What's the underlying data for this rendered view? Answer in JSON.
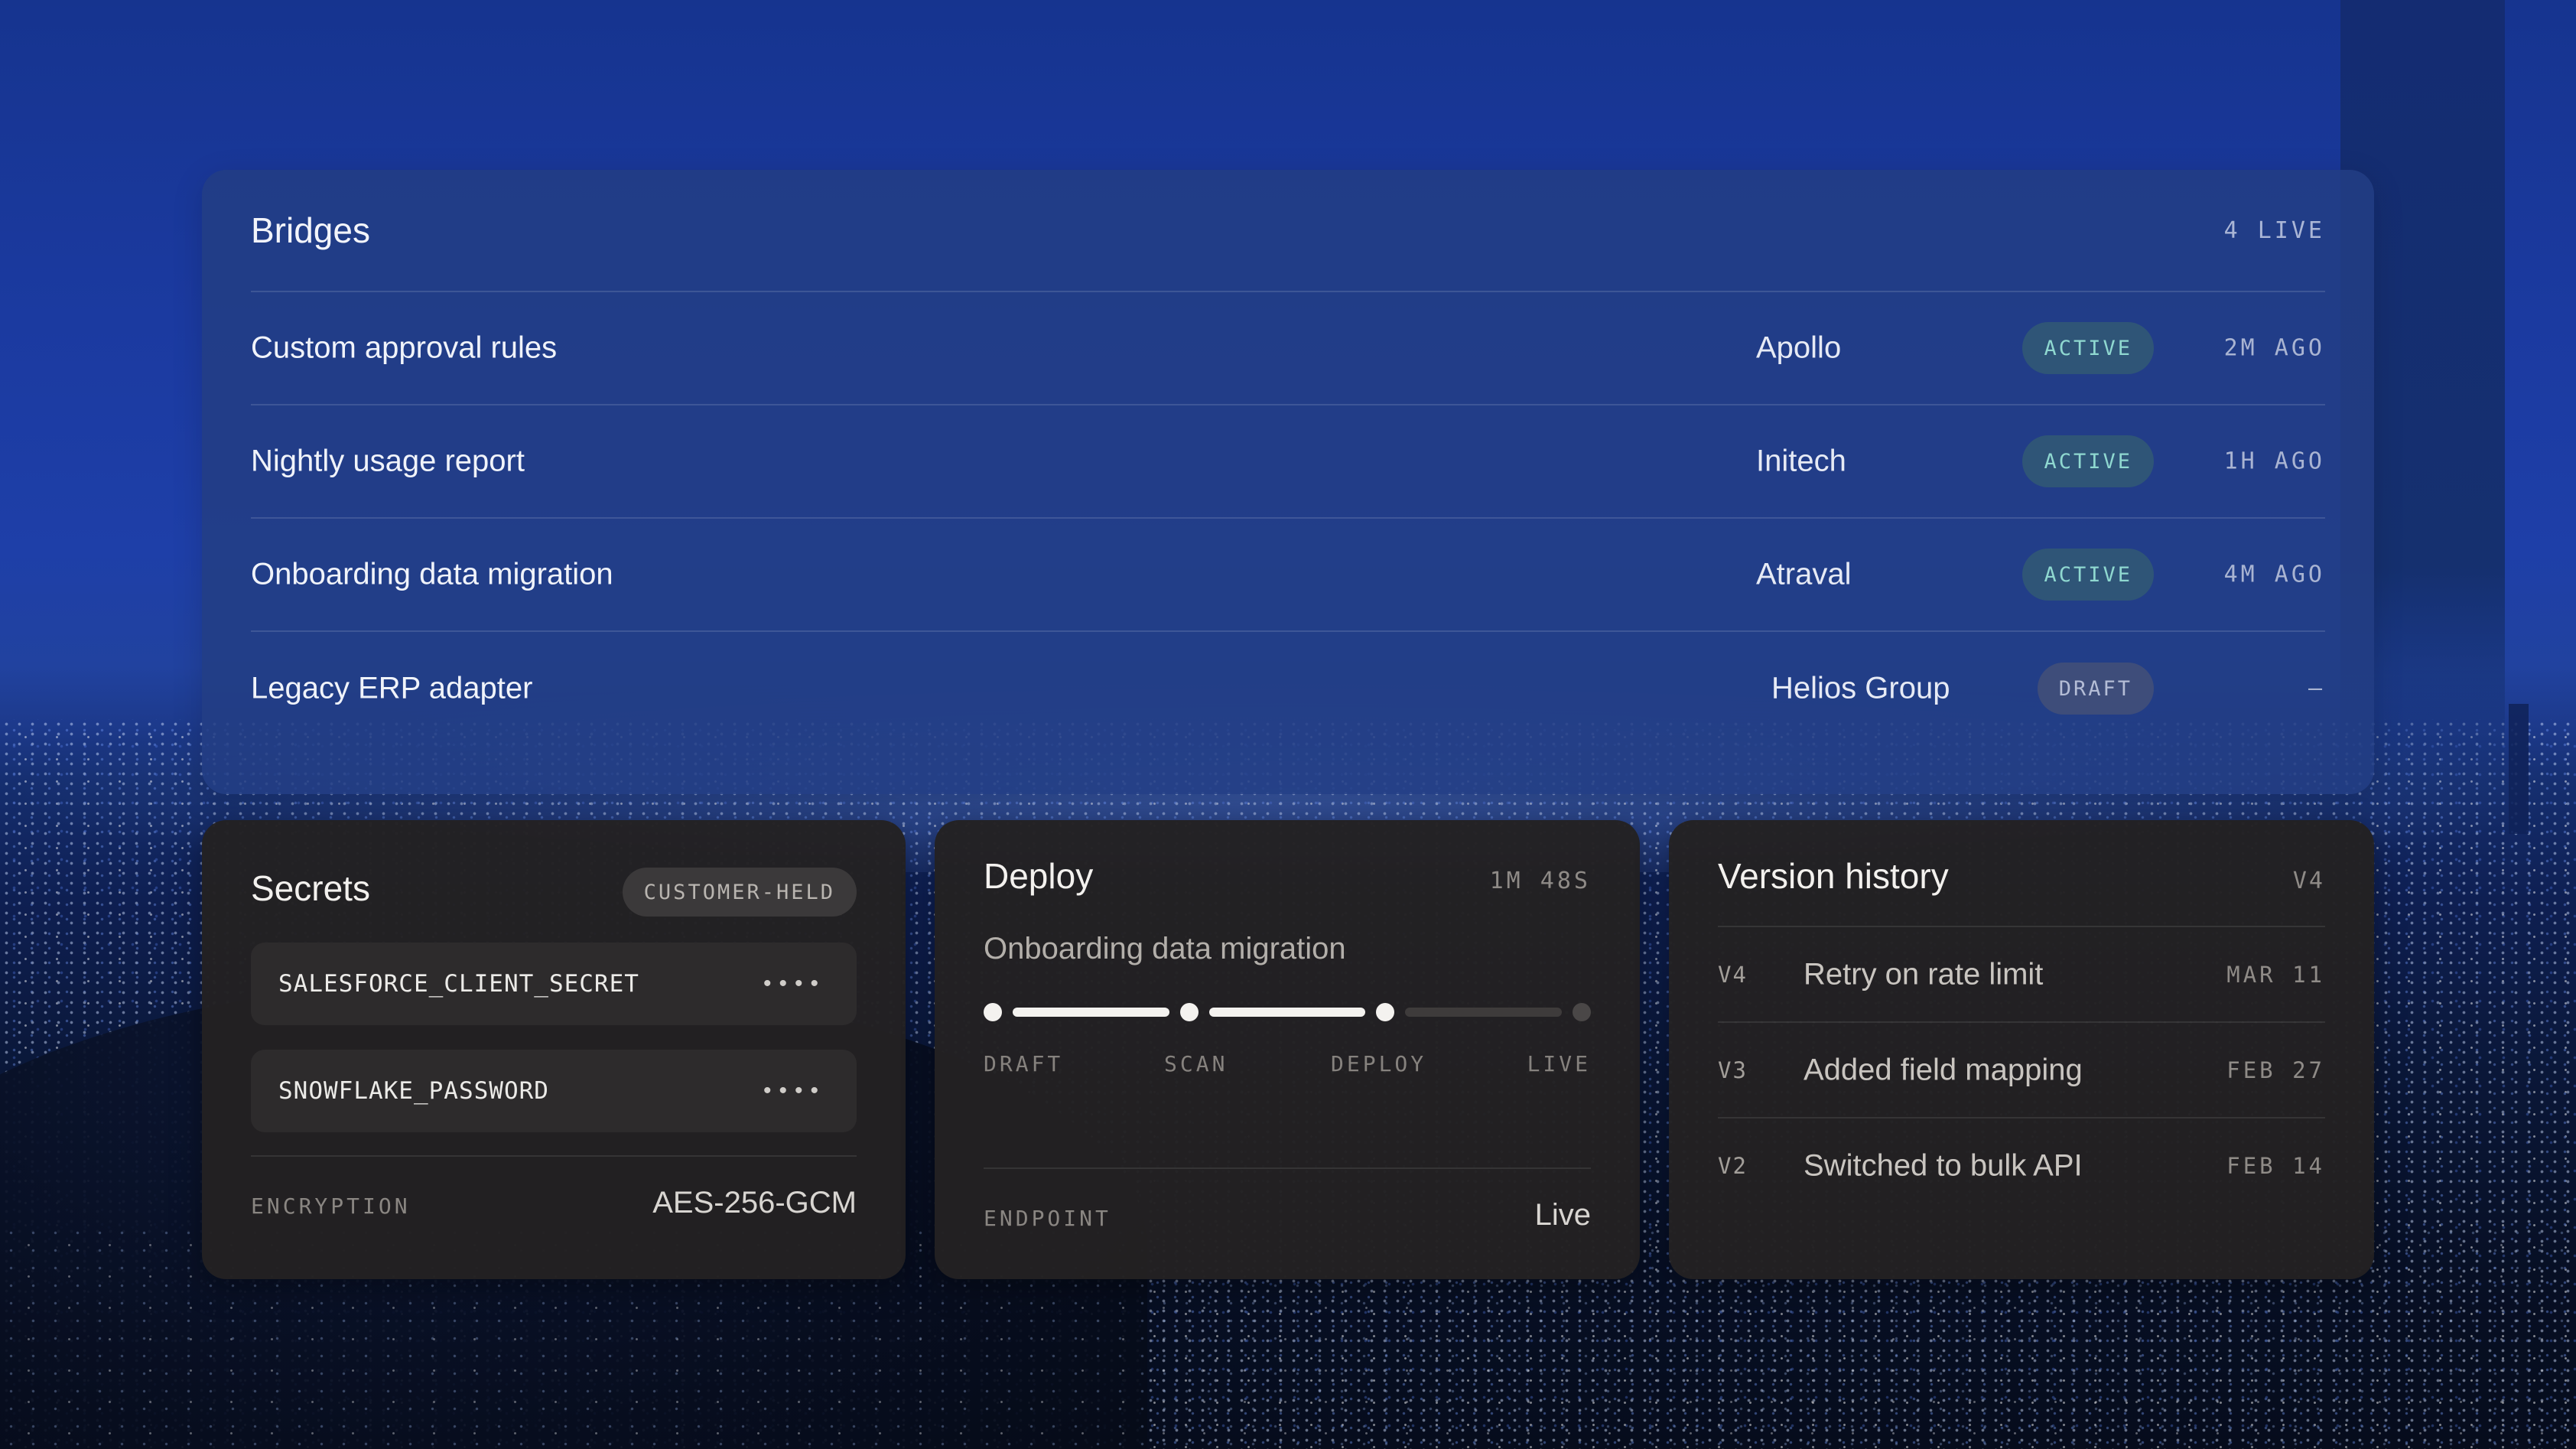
{
  "bridges": {
    "title": "Bridges",
    "live_count": "4 LIVE",
    "rows": [
      {
        "name": "Custom approval rules",
        "client": "Apollo",
        "status": "ACTIVE",
        "time": "2M AGO"
      },
      {
        "name": "Nightly usage report",
        "client": "Initech",
        "status": "ACTIVE",
        "time": "1H AGO"
      },
      {
        "name": "Onboarding data migration",
        "client": "Atraval",
        "status": "ACTIVE",
        "time": "4M AGO"
      },
      {
        "name": "Legacy ERP adapter",
        "client": "Helios Group",
        "status": "DRAFT",
        "time": "–"
      }
    ]
  },
  "secrets": {
    "title": "Secrets",
    "custody_badge": "CUSTOMER-HELD",
    "items": [
      {
        "key": "SALESFORCE_CLIENT_SECRET",
        "masked": "••••"
      },
      {
        "key": "SNOWFLAKE_PASSWORD",
        "masked": "••••"
      }
    ],
    "encryption_label": "ENCRYPTION",
    "encryption_value": "AES-256-GCM"
  },
  "deploy": {
    "title": "Deploy",
    "duration": "1M 48S",
    "subject": "Onboarding data migration",
    "steps": [
      "DRAFT",
      "SCAN",
      "DEPLOY",
      "LIVE"
    ],
    "completed_steps": 3,
    "endpoint_label": "ENDPOINT",
    "endpoint_value": "Live"
  },
  "history": {
    "title": "Version history",
    "current_version": "V4",
    "versions": [
      {
        "version": "V4",
        "message": "Retry on rate limit",
        "date": "MAR 11"
      },
      {
        "version": "V3",
        "message": "Added field mapping",
        "date": "FEB 27"
      },
      {
        "version": "V2",
        "message": "Switched to bulk API",
        "date": "FEB 14"
      }
    ]
  },
  "colors": {
    "active_badge_bg": "#2f5577",
    "active_badge_text": "#8fd8d0",
    "draft_badge_bg": "#3e4d7a",
    "bridges_panel": "#233e84",
    "dark_panel": "#232122"
  }
}
